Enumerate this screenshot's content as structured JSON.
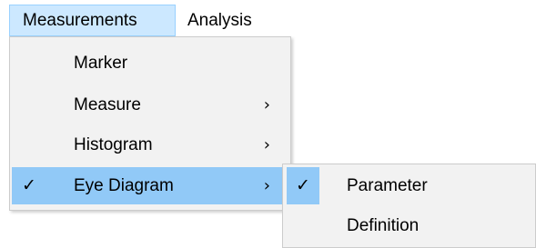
{
  "menubar": {
    "items": [
      {
        "label": "Measurements"
      },
      {
        "label": "Analysis"
      }
    ]
  },
  "measurements_menu": {
    "items": [
      {
        "label": "Marker",
        "submenu": false,
        "checked": false
      },
      {
        "label": "Measure",
        "submenu": true,
        "arrow": "›",
        "checked": false
      },
      {
        "label": "Histogram",
        "submenu": true,
        "arrow": "›",
        "checked": false
      },
      {
        "label": "Eye Diagram",
        "submenu": true,
        "arrow": "›",
        "checked": true,
        "check": "✓"
      }
    ]
  },
  "eye_diagram_submenu": {
    "items": [
      {
        "label": "Parameter",
        "checked": true,
        "check": "✓"
      },
      {
        "label": "Definition",
        "checked": false
      }
    ]
  },
  "colors": {
    "menubar_highlight": "#cce8ff",
    "menu_background": "#f2f2f2",
    "item_highlight": "#91c9f7"
  }
}
